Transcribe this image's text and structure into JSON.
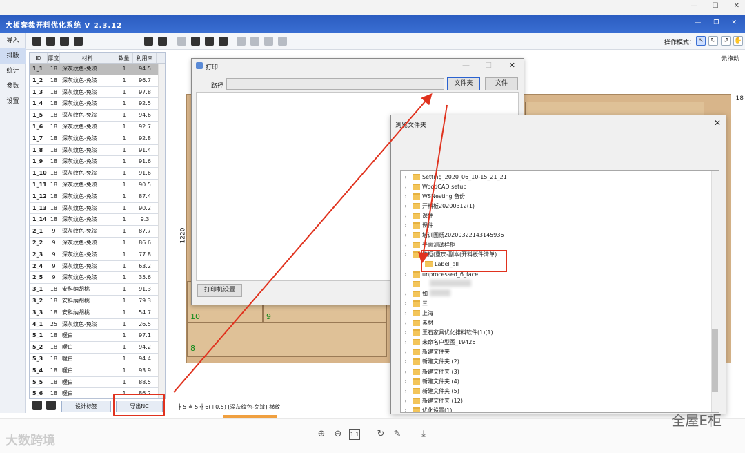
{
  "app": {
    "title": "大板套裁开料优化系统  V 2.3.12"
  },
  "nav": [
    "导入",
    "排版",
    "统计",
    "参数",
    "设置"
  ],
  "nav_active": "排版",
  "toolbar": {
    "opmode_label": "操作模式："
  },
  "table": {
    "columns": [
      "ID",
      "厚度",
      "材料",
      "数量",
      "利用率"
    ],
    "rows": [
      [
        "1_1",
        "18",
        "深灰纹色-免漆",
        "1",
        "94.5"
      ],
      [
        "1_2",
        "18",
        "深灰纹色-免漆",
        "1",
        "96.7"
      ],
      [
        "1_3",
        "18",
        "深灰纹色-免漆",
        "1",
        "97.8"
      ],
      [
        "1_4",
        "18",
        "深灰纹色-免漆",
        "1",
        "92.5"
      ],
      [
        "1_5",
        "18",
        "深灰纹色-免漆",
        "1",
        "94.6"
      ],
      [
        "1_6",
        "18",
        "深灰纹色-免漆",
        "1",
        "92.7"
      ],
      [
        "1_7",
        "18",
        "深灰纹色-免漆",
        "1",
        "92.8"
      ],
      [
        "1_8",
        "18",
        "深灰纹色-免漆",
        "1",
        "91.4"
      ],
      [
        "1_9",
        "18",
        "深灰纹色-免漆",
        "1",
        "91.6"
      ],
      [
        "1_10",
        "18",
        "深灰纹色-免漆",
        "1",
        "91.6"
      ],
      [
        "1_11",
        "18",
        "深灰纹色-免漆",
        "1",
        "90.5"
      ],
      [
        "1_12",
        "18",
        "深灰纹色-免漆",
        "1",
        "87.4"
      ],
      [
        "1_13",
        "18",
        "深灰纹色-免漆",
        "1",
        "90.2"
      ],
      [
        "1_14",
        "18",
        "深灰纹色-免漆",
        "1",
        "9.3"
      ],
      [
        "2_1",
        "9",
        "深灰纹色-免漆",
        "1",
        "87.7"
      ],
      [
        "2_2",
        "9",
        "深灰纹色-免漆",
        "1",
        "86.6"
      ],
      [
        "2_3",
        "9",
        "深灰纹色-免漆",
        "1",
        "77.8"
      ],
      [
        "2_4",
        "9",
        "深灰纹色-免漆",
        "1",
        "63.2"
      ],
      [
        "2_5",
        "9",
        "深灰纹色-免漆",
        "1",
        "35.6"
      ],
      [
        "3_1",
        "18",
        "安科纳胡桃",
        "1",
        "91.3"
      ],
      [
        "3_2",
        "18",
        "安科纳胡桃",
        "1",
        "79.3"
      ],
      [
        "3_3",
        "18",
        "安科纳胡桃",
        "1",
        "54.7"
      ],
      [
        "4_1",
        "25",
        "深灰纹色-免漆",
        "1",
        "26.5"
      ],
      [
        "5_1",
        "18",
        "暖白",
        "1",
        "97.1"
      ],
      [
        "5_2",
        "18",
        "暖白",
        "1",
        "94.2"
      ],
      [
        "5_3",
        "18",
        "暖白",
        "1",
        "94.4"
      ],
      [
        "5_4",
        "18",
        "暖白",
        "1",
        "93.9"
      ],
      [
        "5_5",
        "18",
        "暖白",
        "1",
        "88.5"
      ],
      [
        "5_6",
        "18",
        "暖白",
        "1",
        "86.2"
      ]
    ],
    "label_button": "设计标签",
    "export_button": "导出NC"
  },
  "canvas": {
    "drag_label": "无拖动",
    "dim_height": "1220",
    "dim_thickness": "18",
    "panel_numbers": [
      "10",
      "9",
      "8"
    ],
    "status": "╞ 5 ≛ 5  ╬ 6(+0.5)  [深灰纹色-免漆]  横纹"
  },
  "print_dialog": {
    "title": "打印",
    "path_label": "路径",
    "folder_button": "文件夹",
    "file_button": "文件",
    "printer_settings_button": "打印机设置"
  },
  "browse_dialog": {
    "title": "浏览文件夹",
    "items": [
      "Setting_2020_06_10-15_21_21",
      "WoodCAD setup",
      "WSNesting 备份",
      "开料板20200312(1)",
      "课件",
      "课件",
      "培训图纸20200322143145936",
      "平面测试样柜",
      "衣柜(重庆-副本(开料板件清单)",
      "Label_all",
      "unprocessed_6_face",
      "",
      "如",
      "三",
      "上海",
      "素材",
      "王石家具优化排料软件(1)(1)",
      "未命名户型图_19426",
      "新建文件夹",
      "新建文件夹 (2)",
      "新建文件夹 (3)",
      "新建文件夹 (4)",
      "新建文件夹 (5)",
      "新建文件夹 (12)",
      "优化设置(1)"
    ]
  },
  "watermarks": {
    "left": "大数跨境",
    "right": "全屋E柜"
  },
  "colors": {
    "title_bar": "#2b5cc0",
    "highlight": "#e0321e",
    "board": "#d8b58a",
    "panel_number": "#0f8a1a"
  }
}
